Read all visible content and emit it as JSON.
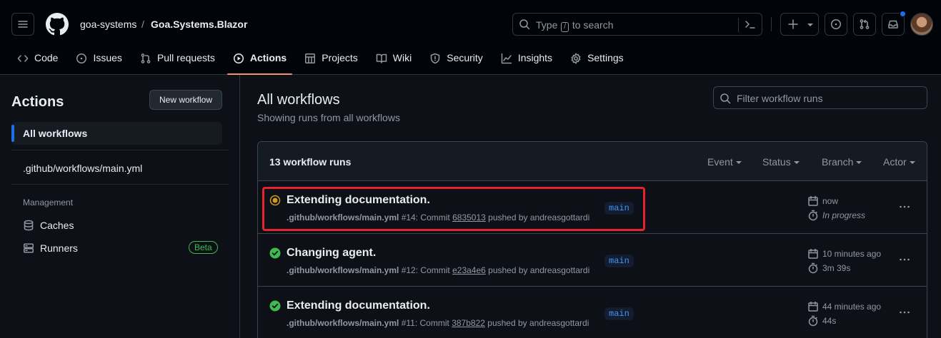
{
  "header": {
    "owner": "goa-systems",
    "separator": "/",
    "repo": "Goa.Systems.Blazor",
    "search": {
      "before": "Type",
      "key": "/",
      "after": "to search"
    }
  },
  "nav": {
    "tabs": [
      {
        "label": "Code",
        "icon": "code-icon",
        "active": false
      },
      {
        "label": "Issues",
        "icon": "issue-icon",
        "active": false
      },
      {
        "label": "Pull requests",
        "icon": "pull-request-icon",
        "active": false
      },
      {
        "label": "Actions",
        "icon": "play-icon",
        "active": true
      },
      {
        "label": "Projects",
        "icon": "table-icon",
        "active": false
      },
      {
        "label": "Wiki",
        "icon": "book-icon",
        "active": false
      },
      {
        "label": "Security",
        "icon": "shield-icon",
        "active": false
      },
      {
        "label": "Insights",
        "icon": "graph-icon",
        "active": false
      },
      {
        "label": "Settings",
        "icon": "gear-icon",
        "active": false
      }
    ]
  },
  "sidebar": {
    "title": "Actions",
    "new_workflow": "New workflow",
    "all_workflows": "All workflows",
    "workflow_file": ".github/workflows/main.yml",
    "management": "Management",
    "caches": "Caches",
    "runners": "Runners",
    "beta": "Beta"
  },
  "main": {
    "title": "All workflows",
    "subtitle": "Showing runs from all workflows",
    "filter_placeholder": "Filter workflow runs",
    "runs_count": "13 workflow runs",
    "filters": {
      "event": "Event",
      "status": "Status",
      "branch": "Branch",
      "actor": "Actor"
    },
    "runs": [
      {
        "title": "Extending documentation.",
        "workflow": ".github/workflows/main.yml",
        "number": "#14",
        "commit_label": "Commit",
        "sha": "6835013",
        "pushed_by": "pushed by andreasgottardi",
        "branch": "main",
        "time": "now",
        "duration": "In progress",
        "status": "in-progress"
      },
      {
        "title": "Changing agent.",
        "workflow": ".github/workflows/main.yml",
        "number": "#12",
        "commit_label": "Commit",
        "sha": "e23a4e6",
        "pushed_by": "pushed by andreasgottardi",
        "branch": "main",
        "time": "10 minutes ago",
        "duration": "3m 39s",
        "status": "success"
      },
      {
        "title": "Extending documentation.",
        "workflow": ".github/workflows/main.yml",
        "number": "#11",
        "commit_label": "Commit",
        "sha": "387b822",
        "pushed_by": "pushed by andreasgottardi",
        "branch": "main",
        "time": "44 minutes ago",
        "duration": "44s",
        "status": "success"
      }
    ]
  },
  "colors": {
    "accent_underline": "#fd8c73",
    "success": "#3fb950",
    "in_progress": "#d29922",
    "highlight": "#e5252b",
    "link": "#4493f8"
  }
}
